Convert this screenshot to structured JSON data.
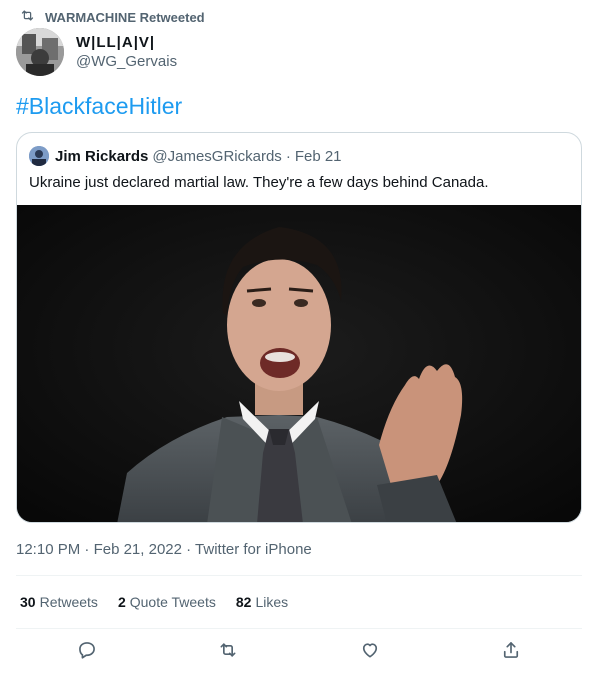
{
  "retweet_context": {
    "text": "WARMACHINE Retweeted",
    "icon": "retweet-icon"
  },
  "author": {
    "name": "W|LL|A|V|",
    "handle": "@WG_Gervais"
  },
  "tweet": {
    "text": "#BlackfaceHitler",
    "link_color": "#1d9bf0"
  },
  "quoted_tweet": {
    "name": "Jim Rickards",
    "handle": "@JamesGRickards",
    "separator": "·",
    "date": "Feb 21",
    "text": "Ukraine just declared martial law. They're a few days behind Canada."
  },
  "meta": {
    "time": "12:10 PM",
    "sep1": "·",
    "date": "Feb 21, 2022",
    "sep2": "·",
    "source": "Twitter for iPhone"
  },
  "stats": {
    "retweets": {
      "count": "30",
      "label": "Retweets"
    },
    "quote_tweets": {
      "count": "2",
      "label": "Quote Tweets"
    },
    "likes": {
      "count": "82",
      "label": "Likes"
    }
  },
  "actions": [
    {
      "name": "reply",
      "icon": "reply-icon"
    },
    {
      "name": "retweet",
      "icon": "retweet-icon"
    },
    {
      "name": "like",
      "icon": "heart-icon"
    },
    {
      "name": "share",
      "icon": "share-icon"
    }
  ],
  "colors": {
    "text_primary": "#0f1419",
    "text_secondary": "#536471",
    "border": "#cfd9de",
    "divider": "#eff3f4"
  }
}
